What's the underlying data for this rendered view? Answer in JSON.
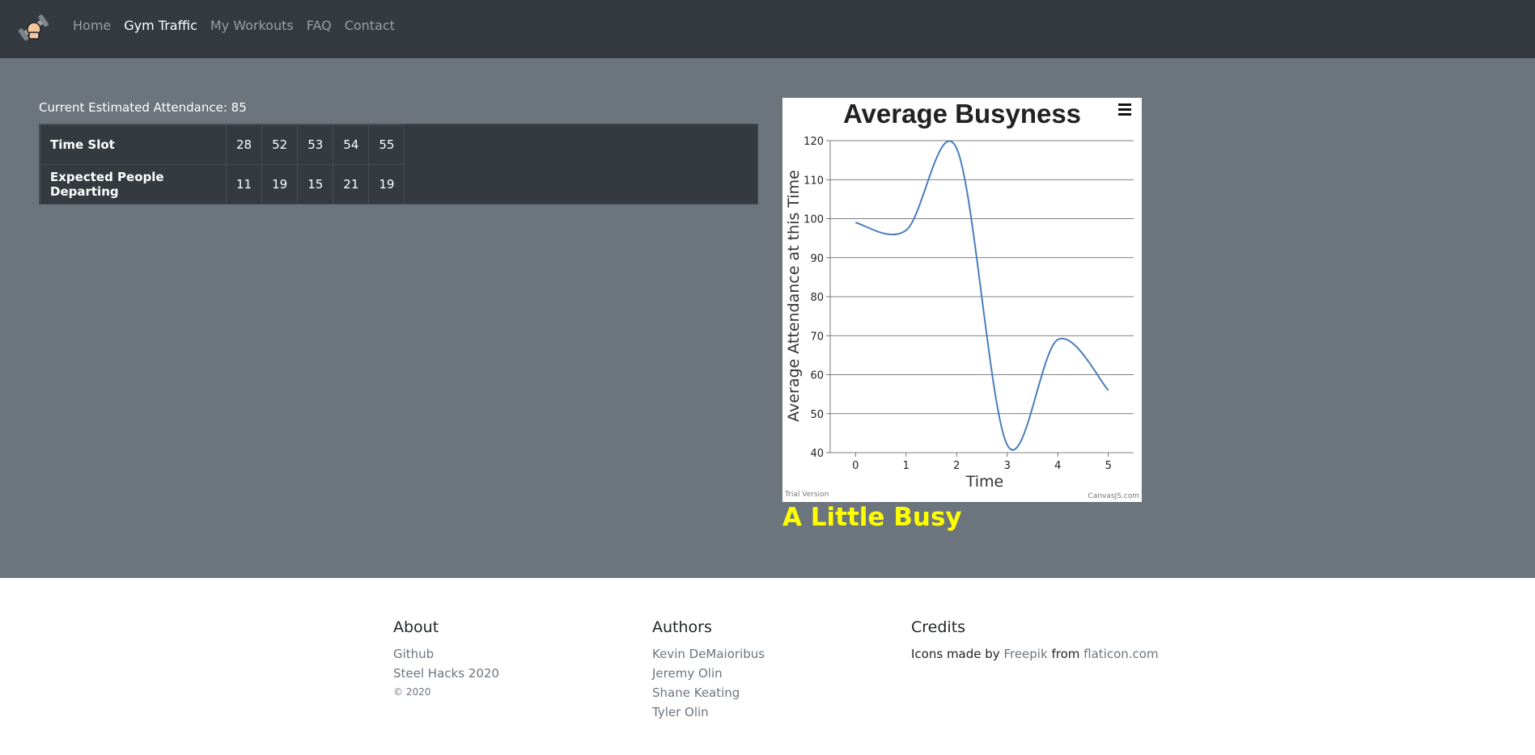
{
  "nav": {
    "logo_icon": "dumbbell-hand-icon",
    "links": [
      {
        "label": "Home",
        "active": false
      },
      {
        "label": "Gym Traffic",
        "active": true
      },
      {
        "label": "My Workouts",
        "active": false
      },
      {
        "label": "FAQ",
        "active": false
      },
      {
        "label": "Contact",
        "active": false
      }
    ]
  },
  "main": {
    "attendance_text": "Current Estimated Attendance: 85",
    "table": {
      "row1_header": "Time Slot",
      "row1_values": [
        "28",
        "52",
        "53",
        "54",
        "55"
      ],
      "row2_header": "Expected People Departing",
      "row2_values": [
        "11",
        "19",
        "15",
        "21",
        "19"
      ]
    },
    "busy_status": "A Little Busy",
    "busy_color": "#ffff00"
  },
  "chart_data": {
    "type": "line",
    "title": "Average Busyness",
    "xlabel": "Time",
    "ylabel": "Average Attendance at this Time",
    "x": [
      0,
      1,
      2,
      3,
      4,
      5
    ],
    "series": [
      {
        "values": [
          99,
          97,
          118,
          42,
          69,
          56
        ],
        "color": "#4a7ebb"
      }
    ],
    "xlim": [
      -0.5,
      5.5
    ],
    "ylim": [
      40,
      120
    ],
    "yticks": [
      40,
      50,
      60,
      70,
      80,
      90,
      100,
      110,
      120
    ],
    "grid": true,
    "menu_icon": "hamburger-menu-icon",
    "watermark_left": "Trial Version",
    "watermark_right": "CanvasJS.com"
  },
  "footer": {
    "about": {
      "heading": "About",
      "links": [
        "Github",
        "Steel Hacks 2020"
      ],
      "copyright": "© 2020"
    },
    "authors": {
      "heading": "Authors",
      "names": [
        "Kevin DeMaioribus",
        "Jeremy Olin",
        "Shane Keating",
        "Tyler Olin"
      ]
    },
    "credits": {
      "heading": "Credits",
      "prefix": "Icons made by",
      "link1": "Freepik",
      "middle": "from",
      "link2": "flaticon.com"
    }
  }
}
